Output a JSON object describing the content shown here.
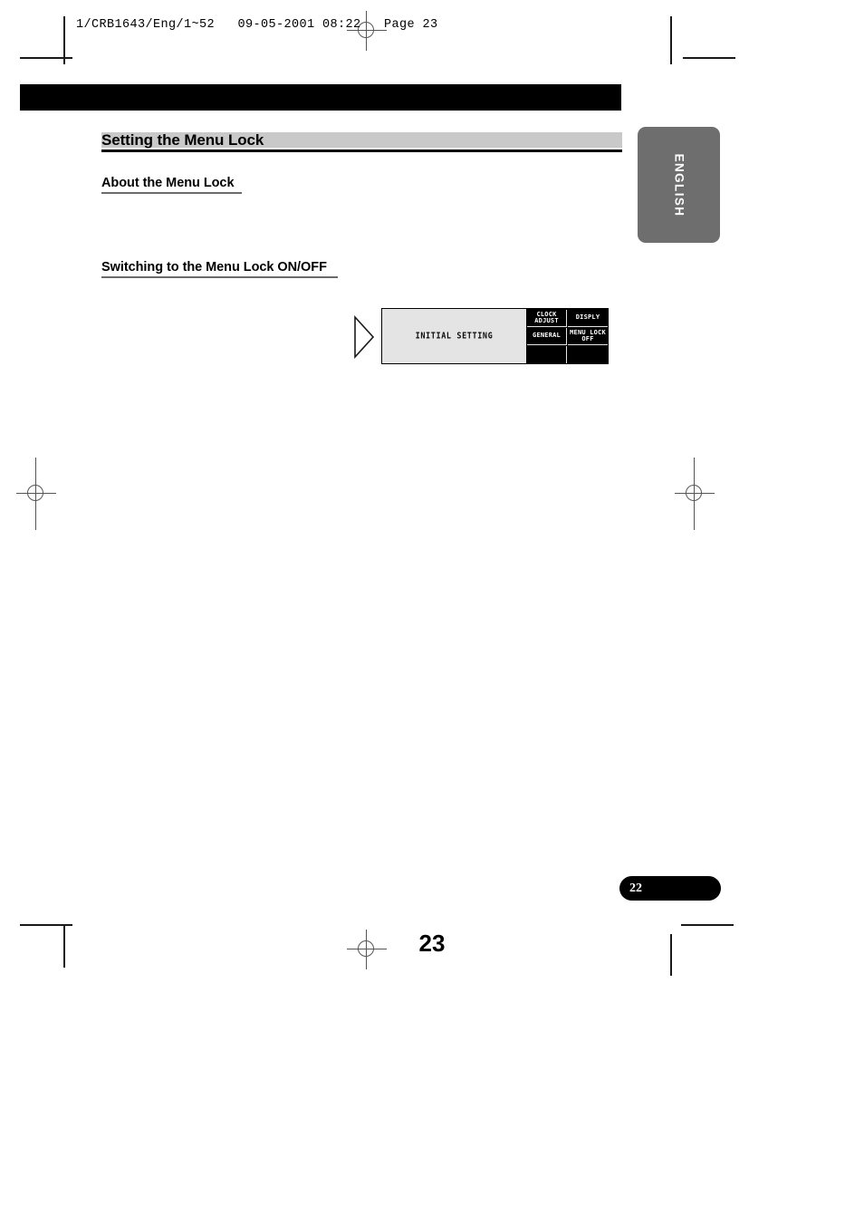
{
  "page": {
    "slug_line": "1/CRB1643/Eng/1~52   09-05-2001 08:22   Page 23",
    "folio_number": "23",
    "reference_page": "22",
    "language_tab": "ENGLISH"
  },
  "headings": {
    "section": "Setting the Menu Lock",
    "sub_about": "About the Menu Lock",
    "sub_switching": "Switching to the Menu Lock ON/OFF"
  },
  "lcd_display": {
    "arrow": "triangle-right",
    "main_label": "INITIAL SETTING",
    "cells": [
      "CLOCK\nADJUST",
      "DISPLY",
      "GENERAL",
      "MENU LOCK\nOFF",
      "",
      ""
    ]
  },
  "colors": {
    "banner": "#000000",
    "heading_band": "#c9c9c9",
    "subhead_rule": "#6b6b6b",
    "lang_tab": "#6e6e6e",
    "lcd_background": "#e4e4e4",
    "lcd_grid": "#000000"
  }
}
